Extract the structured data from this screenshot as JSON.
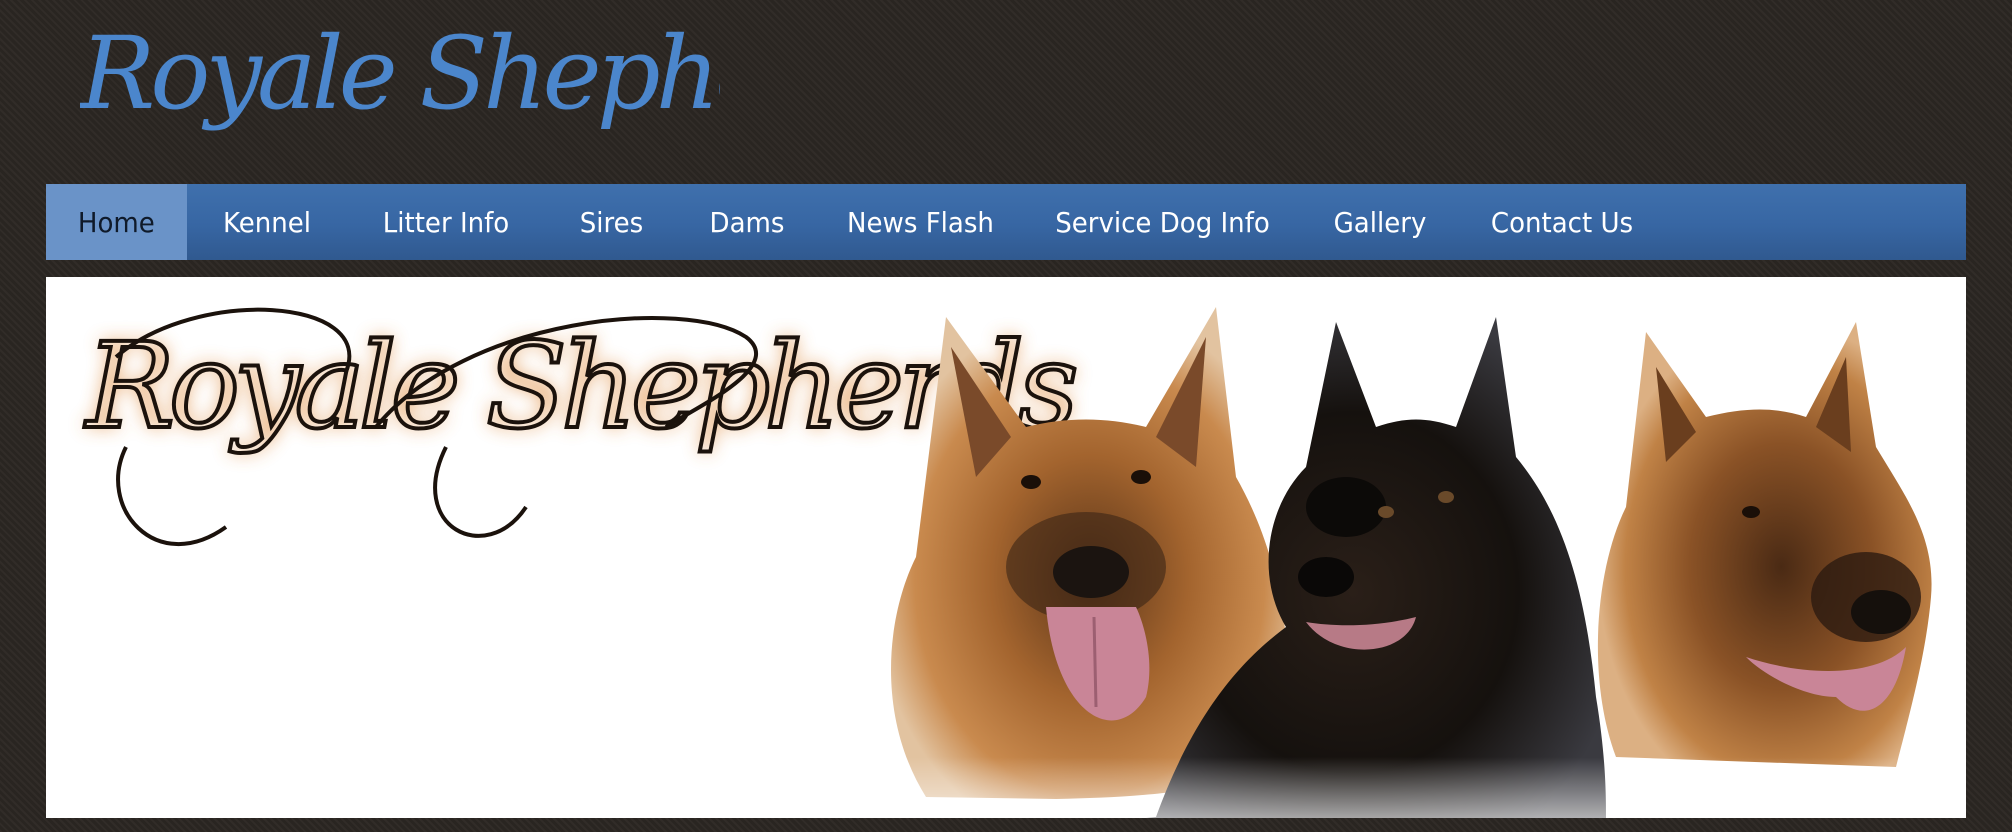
{
  "site": {
    "title": "Royale Shepherds"
  },
  "nav": {
    "items": [
      {
        "label": "Home",
        "active": true
      },
      {
        "label": "Kennel",
        "active": false
      },
      {
        "label": "Litter Info",
        "active": false
      },
      {
        "label": "Sires",
        "active": false
      },
      {
        "label": "Dams",
        "active": false
      },
      {
        "label": "News Flash",
        "active": false
      },
      {
        "label": "Service Dog Info",
        "active": false
      },
      {
        "label": "Gallery",
        "active": false
      },
      {
        "label": "Contact Us",
        "active": false
      }
    ]
  },
  "banner": {
    "logo_text": "Royale Shepherds",
    "dogs": [
      "tan-german-shepherd",
      "black-german-shepherd",
      "sable-german-shepherd"
    ]
  },
  "colors": {
    "page_background": "#2b2622",
    "title_blue": "#4b86cc",
    "nav_blue": "#3766a3",
    "nav_active": "#6a93c8",
    "banner_glow": "#d98a3c"
  }
}
